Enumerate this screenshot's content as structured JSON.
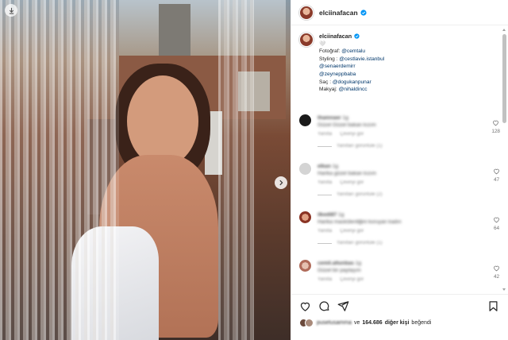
{
  "post": {
    "username": "elciinafacan",
    "caption_symbol": "🤍",
    "caption_lines": [
      {
        "prefix": "Fotoğraf: ",
        "link": "@cemtalu"
      },
      {
        "prefix": "Styling : ",
        "link": "@cestlavie.istanbul"
      },
      {
        "prefix": "",
        "link": "@senaerdemirr"
      },
      {
        "prefix": "",
        "link": "@zeyneppbaba"
      },
      {
        "prefix": "Saç : ",
        "link": "@dogukanpunar"
      },
      {
        "prefix": "Makyaj: ",
        "link": "@nihaldincc"
      }
    ]
  },
  "comments": [
    {
      "user": "thamnaer",
      "age": "1g",
      "text": "Güzel Güzel bakan kızım",
      "meta_a": "Yanıtla",
      "meta_b": "Çeviriyi gör",
      "replies": "Yanıtları görüntüle (1)",
      "likes": "128",
      "avatar": "#1a1a1a"
    },
    {
      "user": "elkan",
      "age": "1g",
      "text": "Harika güzel bakan kızım",
      "meta_a": "Yanıtla",
      "meta_b": "Çeviriyi gör",
      "replies": "Yanıtları görüntüle (2)",
      "likes": "47",
      "avatar": "#cfcfcf"
    },
    {
      "user": "ilkedi87",
      "age": "1g",
      "text": "Harika maskülenliğini koruyan kadın",
      "meta_a": "Yanıtla",
      "meta_b": "Çeviriyi gör",
      "replies": "Yanıtları görüntüle (1)",
      "likes": "64",
      "avatar": "#b04a3a"
    },
    {
      "user": "cemil.altunbas",
      "age": "1g",
      "text": "Güzel bir paylaşım",
      "meta_a": "Yanıtla",
      "meta_b": "Çeviriyi gör",
      "replies": "",
      "likes": "42",
      "avatar": "#c09080"
    }
  ],
  "likes_bar": {
    "blurred_user": "pusetusamma",
    "and": "ve",
    "count": "164.686",
    "others": "diğer kişi",
    "suffix": "beğendi"
  },
  "colors": {
    "link": "#00376b",
    "verified": "#0095f6",
    "text": "#262626",
    "muted": "#737373"
  },
  "icons": {
    "download": "download-icon",
    "next": "chevron-right-icon",
    "heart": "heart-icon",
    "comment": "comment-icon",
    "share": "share-icon",
    "save": "bookmark-icon",
    "verified": "verified-badge-icon"
  }
}
